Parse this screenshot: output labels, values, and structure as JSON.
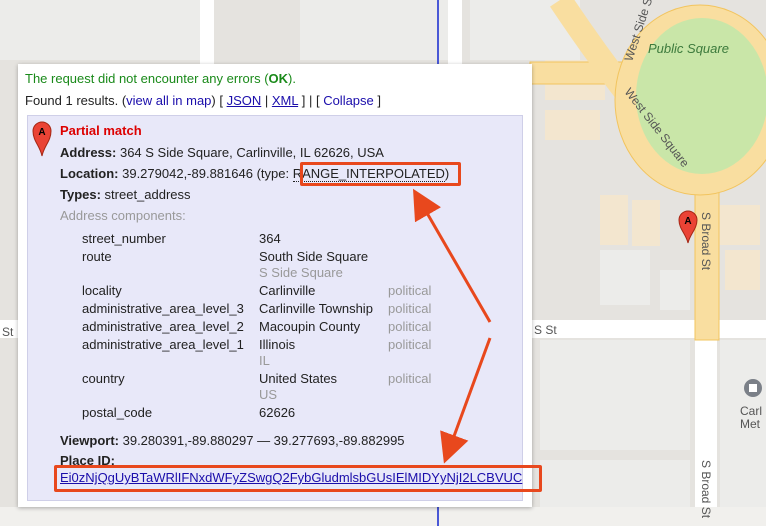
{
  "map": {
    "labels": {
      "public_square": "Public Square",
      "west_side_sq_top": "West Side Sq",
      "west_side_square": "West Side Square",
      "s_broad_st_upper": "S Broad St",
      "s_broad_st_lower": "S Broad St",
      "s_st_left": "St",
      "s_st_right": "S St",
      "poi_line1": "Carl",
      "poi_line2": "Met"
    },
    "marker_letter": "A",
    "colors": {
      "road": "#ffffff",
      "road_major": "#f9dea0",
      "road_border": "#f2c45e",
      "park": "#c9e6a8",
      "building": "#f3e6cf",
      "building_gray": "#ececea",
      "background": "#e5e3df",
      "route_line": "#4a58d6",
      "arrow": "#e8481d",
      "marker": "#ea4335"
    }
  },
  "panel": {
    "status_text": "The request did not encounter any errors (",
    "status_ok": "OK",
    "status_end": ").",
    "found_text": "Found 1 results. (",
    "view_all": "view all in map",
    "found_mid": ") [ ",
    "json": "JSON",
    "sep": " | ",
    "xml": "XML",
    "found_mid2": " ] | [ ",
    "collapse": "Collapse",
    "found_end": " ]",
    "result": {
      "marker_letter": "A",
      "title": "Partial match",
      "address_label": "Address:",
      "address_value": " 364 S Side Square, Carlinville, IL 62626, USA",
      "location_label": "Location:",
      "location_value": " 39.279042,-89.881646 (type: ",
      "location_type": "RANGE_INTERPOLATED",
      "location_end": ")",
      "types_label": "Types:",
      "types_value": " street_address",
      "components_label": "Address components:",
      "components": [
        {
          "type": "street_number",
          "long": "364",
          "short": "",
          "extra": ""
        },
        {
          "type": "route",
          "long": "South Side Square",
          "short": "S Side Square",
          "extra": ""
        },
        {
          "type": "locality",
          "long": "Carlinville",
          "short": "",
          "extra": "political"
        },
        {
          "type": "administrative_area_level_3",
          "long": "Carlinville Township",
          "short": "",
          "extra": "political"
        },
        {
          "type": "administrative_area_level_2",
          "long": "Macoupin County",
          "short": "",
          "extra": "political"
        },
        {
          "type": "administrative_area_level_1",
          "long": "Illinois",
          "short": "IL",
          "extra": "political"
        },
        {
          "type": "country",
          "long": "United States",
          "short": "US",
          "extra": "political"
        },
        {
          "type": "postal_code",
          "long": "62626",
          "short": "",
          "extra": ""
        }
      ],
      "viewport_label": "Viewport:",
      "viewport_value": " 39.280391,-89.880297 — 39.277693,-89.882995",
      "place_id_label": "Place ID:",
      "place_id_value": "Ei0zNjQgUyBTaWRlIFNxdWFyZSwgQ2FybGludmlsbGUsIElMIDYyNjI2LCBVUC"
    }
  }
}
